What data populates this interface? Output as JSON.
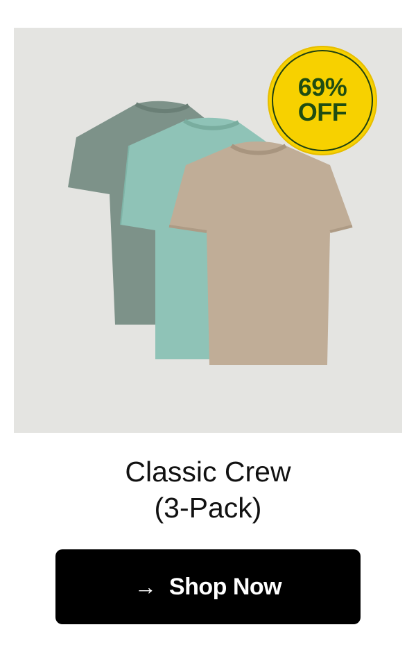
{
  "product": {
    "image_alt": "Three crew neck t-shirts in heather sage, mint and taupe",
    "badge": {
      "line1": "69%",
      "line2": "OFF"
    },
    "title_line1": "Classic Crew",
    "title_line2": "(3-Pack)",
    "shirt_colors": [
      "#7d9289",
      "#8fc3b7",
      "#c0ad97"
    ]
  },
  "cta": {
    "arrow": "→",
    "label": "Shop Now",
    "icon": "arrow-right-icon"
  },
  "colors": {
    "background": "#ffffff",
    "image_background": "#e4e4e1",
    "badge_fill": "#f7d100",
    "badge_text": "#1f4d12",
    "button_fill": "#000000",
    "button_text": "#ffffff"
  }
}
